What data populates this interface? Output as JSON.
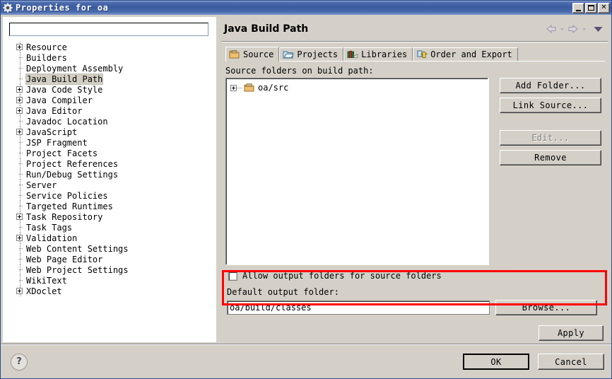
{
  "window": {
    "title": "Properties for oa",
    "title_icon": "gear-icon",
    "controls": {
      "minimize": "minimize-icon",
      "maximize": "maximize-icon",
      "close": "✕"
    }
  },
  "sidebar": {
    "filter": {
      "value": "",
      "placeholder": ""
    },
    "items": [
      {
        "label": "Resource",
        "expandable": true,
        "selected": false
      },
      {
        "label": "Builders",
        "expandable": false,
        "selected": false
      },
      {
        "label": "Deployment Assembly",
        "expandable": false,
        "selected": false
      },
      {
        "label": "Java Build Path",
        "expandable": false,
        "selected": true
      },
      {
        "label": "Java Code Style",
        "expandable": true,
        "selected": false
      },
      {
        "label": "Java Compiler",
        "expandable": true,
        "selected": false
      },
      {
        "label": "Java Editor",
        "expandable": true,
        "selected": false
      },
      {
        "label": "Javadoc Location",
        "expandable": false,
        "selected": false
      },
      {
        "label": "JavaScript",
        "expandable": true,
        "selected": false
      },
      {
        "label": "JSP Fragment",
        "expandable": false,
        "selected": false
      },
      {
        "label": "Project Facets",
        "expandable": false,
        "selected": false
      },
      {
        "label": "Project References",
        "expandable": false,
        "selected": false
      },
      {
        "label": "Run/Debug Settings",
        "expandable": false,
        "selected": false
      },
      {
        "label": "Server",
        "expandable": false,
        "selected": false
      },
      {
        "label": "Service Policies",
        "expandable": false,
        "selected": false
      },
      {
        "label": "Targeted Runtimes",
        "expandable": false,
        "selected": false
      },
      {
        "label": "Task Repository",
        "expandable": true,
        "selected": false
      },
      {
        "label": "Task Tags",
        "expandable": false,
        "selected": false
      },
      {
        "label": "Validation",
        "expandable": true,
        "selected": false
      },
      {
        "label": "Web Content Settings",
        "expandable": false,
        "selected": false
      },
      {
        "label": "Web Page Editor",
        "expandable": false,
        "selected": false
      },
      {
        "label": "Web Project Settings",
        "expandable": false,
        "selected": false
      },
      {
        "label": "WikiText",
        "expandable": false,
        "selected": false
      },
      {
        "label": "XDoclet",
        "expandable": true,
        "selected": false
      }
    ]
  },
  "page": {
    "title": "Java Build Path",
    "nav": {
      "back": "back-arrow-icon",
      "back_menu": "chevron-down-icon",
      "forward": "forward-arrow-icon",
      "forward_menu": "chevron-down-icon",
      "view_menu": "triangle-down-icon"
    },
    "tabs": [
      {
        "label": "Source",
        "icon": "source-folder-icon",
        "active": true
      },
      {
        "label": "Projects",
        "icon": "project-folder-icon",
        "active": false
      },
      {
        "label": "Libraries",
        "icon": "library-books-icon",
        "active": false
      },
      {
        "label": "Order and Export",
        "icon": "order-export-icon",
        "active": false
      }
    ],
    "source_tab": {
      "list_label": "Source folders on build path:",
      "entries": [
        {
          "label": "oa/src",
          "icon": "source-folder-icon",
          "expandable": true
        }
      ],
      "buttons": [
        {
          "label": "Add Folder...",
          "disabled": false
        },
        {
          "label": "Link Source...",
          "disabled": false
        },
        {
          "label": "Edit...",
          "disabled": true
        },
        {
          "label": "Remove",
          "disabled": false
        }
      ],
      "allow_output_checkbox": {
        "label": "Allow output folders for source folders",
        "checked": false
      },
      "default_output": {
        "label": "Default output folder:",
        "value": "oa/build/classes",
        "browse_label": "Browse..."
      },
      "apply_label": "Apply"
    }
  },
  "footer": {
    "help_icon": "question-mark-icon",
    "help_glyph": "?",
    "ok_label": "OK",
    "cancel_label": "Cancel"
  },
  "annotations": {
    "highlight_color": "#ff0000",
    "highlight_target": "default-output-folder-group"
  }
}
